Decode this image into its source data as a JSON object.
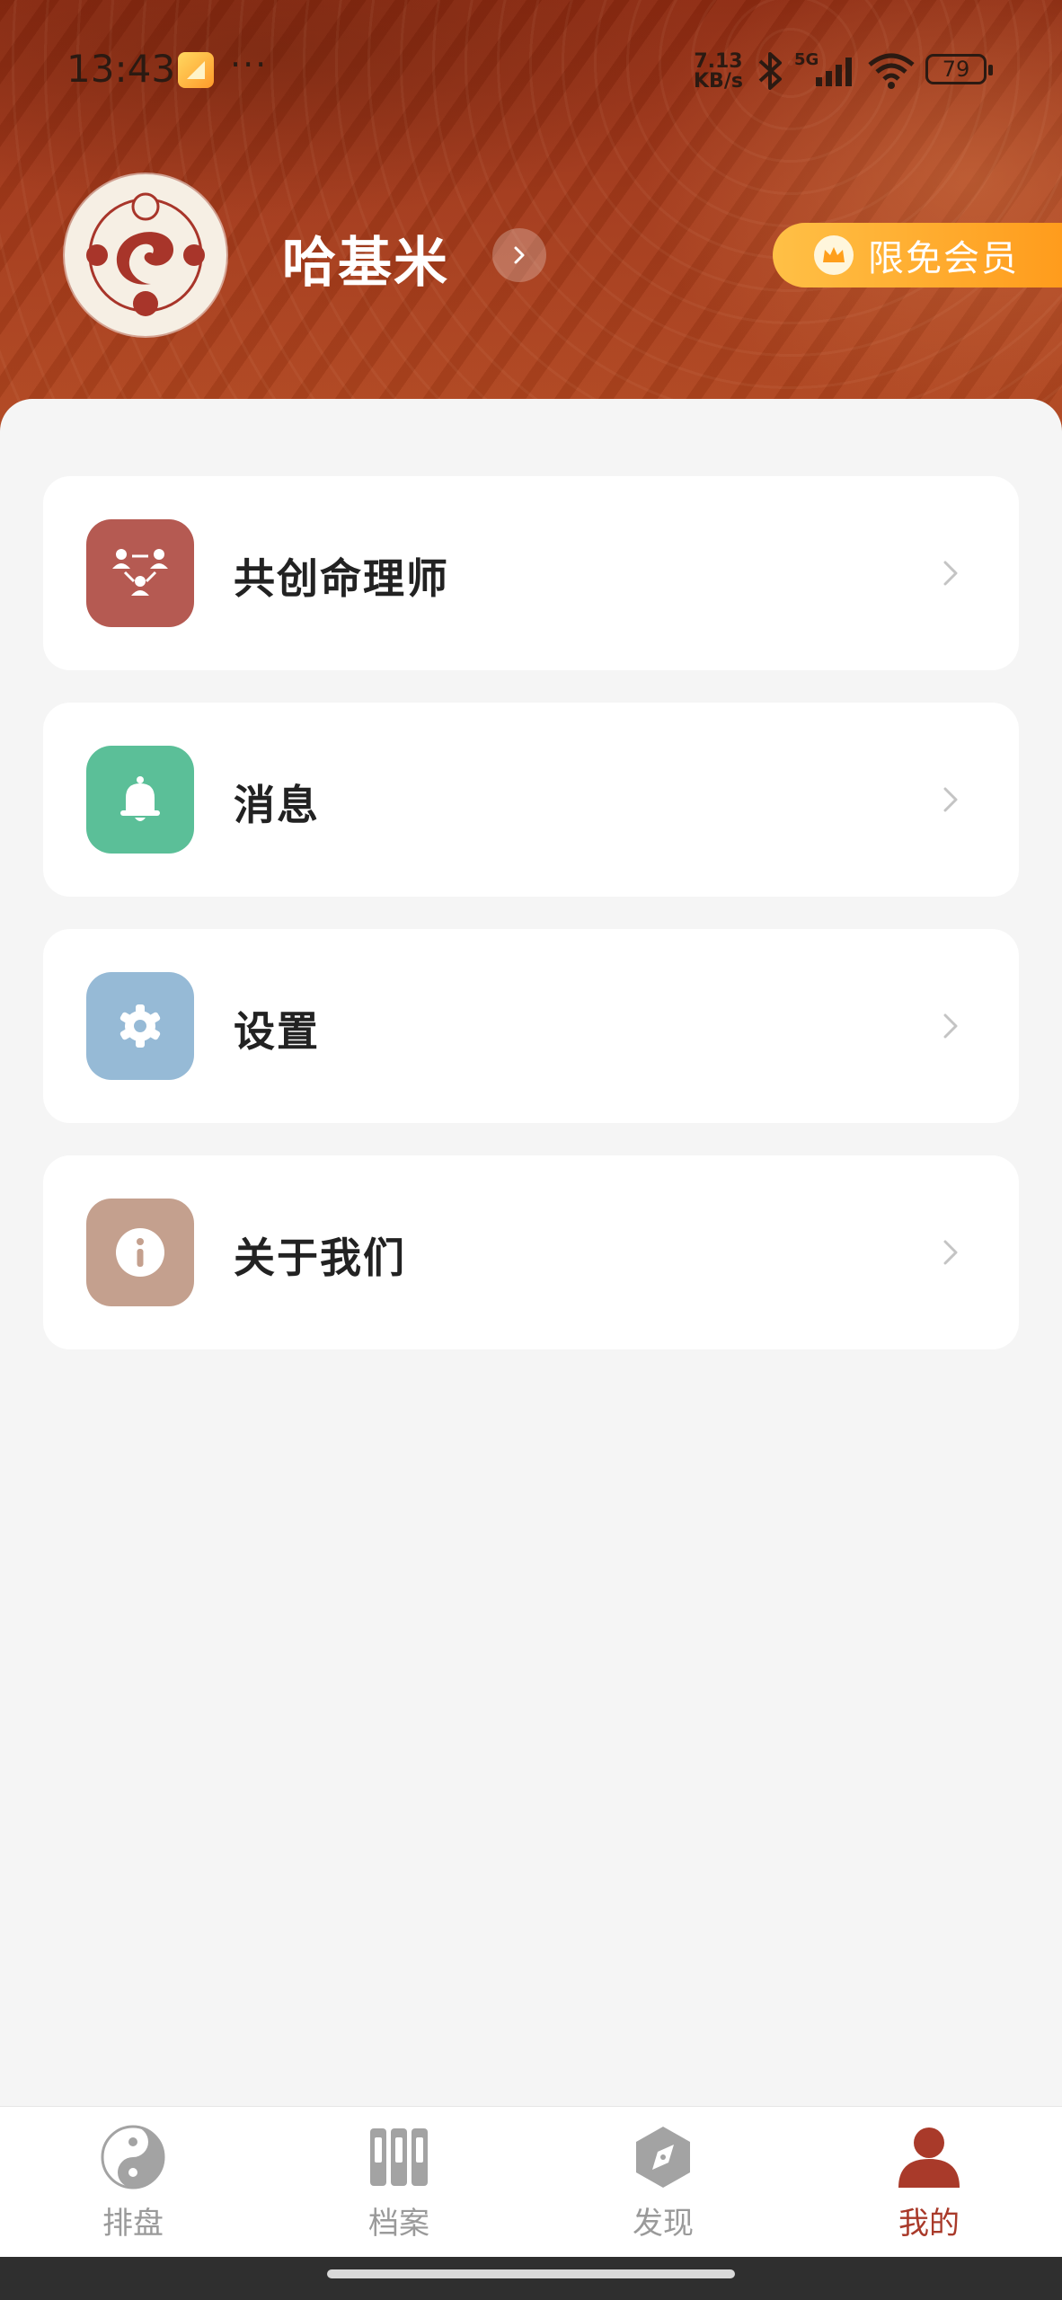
{
  "status_bar": {
    "time": "13:43",
    "more": "···",
    "net_speed_value": "7.13",
    "net_speed_unit": "KB/s",
    "network": "5G",
    "battery": "79"
  },
  "profile": {
    "username": "哈基米",
    "vip_label": "限免会员"
  },
  "menu": [
    {
      "label": "共创命理师",
      "icon": "team-icon",
      "color": "#b55a52"
    },
    {
      "label": "消息",
      "icon": "bell-icon",
      "color": "#5bbf98"
    },
    {
      "label": "设置",
      "icon": "gear-icon",
      "color": "#96bad6"
    },
    {
      "label": "关于我们",
      "icon": "info-icon",
      "color": "#c4a08e"
    }
  ],
  "nav": [
    {
      "label": "排盘",
      "icon": "yin-yang-icon",
      "active": false
    },
    {
      "label": "档案",
      "icon": "archive-icon",
      "active": false
    },
    {
      "label": "发现",
      "icon": "compass-icon",
      "active": false
    },
    {
      "label": "我的",
      "icon": "user-icon",
      "active": true
    }
  ],
  "colors": {
    "header": "#9c3417",
    "accent": "#a93a2a",
    "vip": "#ffb02e",
    "background": "#f5f5f5"
  }
}
